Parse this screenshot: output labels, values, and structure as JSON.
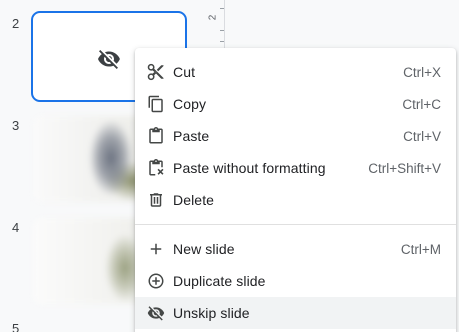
{
  "filmstrip": {
    "slides": [
      {
        "number": "2",
        "skipped": true
      },
      {
        "number": "3"
      },
      {
        "number": "4"
      },
      {
        "number": "5"
      }
    ]
  },
  "ruler": {
    "label": "2"
  },
  "context_menu": {
    "items": [
      {
        "label": "Cut",
        "shortcut": "Ctrl+X",
        "icon": "cut-icon"
      },
      {
        "label": "Copy",
        "shortcut": "Ctrl+C",
        "icon": "copy-icon"
      },
      {
        "label": "Paste",
        "shortcut": "Ctrl+V",
        "icon": "paste-icon"
      },
      {
        "label": "Paste without formatting",
        "shortcut": "Ctrl+Shift+V",
        "icon": "paste-without-formatting-icon"
      },
      {
        "label": "Delete",
        "shortcut": "",
        "icon": "trash-icon"
      },
      {
        "label": "New slide",
        "shortcut": "Ctrl+M",
        "icon": "plus-icon"
      },
      {
        "label": "Duplicate slide",
        "shortcut": "",
        "icon": "duplicate-icon"
      },
      {
        "label": "Unskip slide",
        "shortcut": "",
        "icon": "eye-off-icon",
        "highlighted": true
      }
    ]
  },
  "colors": {
    "accent": "#1a73e8",
    "hover": "#f1f3f4",
    "text": "#202124",
    "secondary": "#5f6368"
  }
}
